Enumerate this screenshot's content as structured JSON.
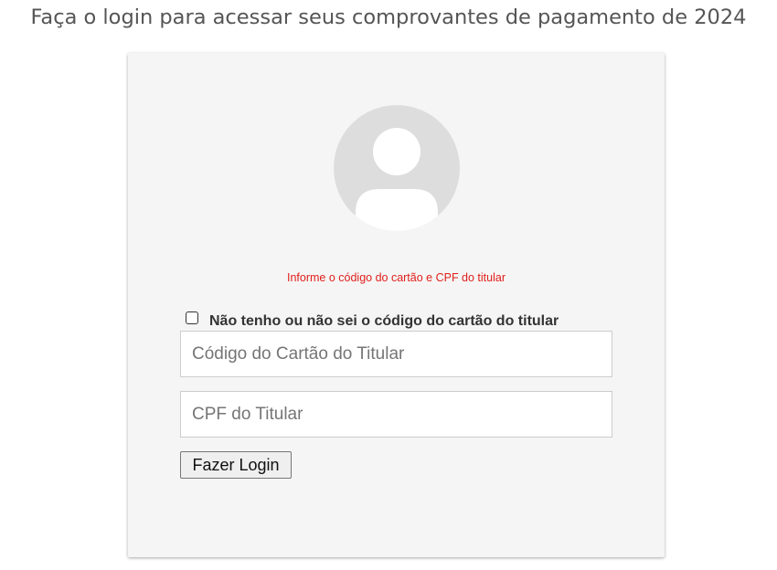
{
  "header": {
    "title": "Faça o login para acessar seus comprovantes de pagamento de 2024"
  },
  "login": {
    "avatar_icon": "user-avatar-icon",
    "message": "Informe o código do cartão e CPF do titular",
    "message_color": "#e0201c",
    "checkbox": {
      "label": "Não tenho ou não sei o código do cartão do titular",
      "checked": false
    },
    "card_code": {
      "placeholder": "Código do Cartão do Titular",
      "value": ""
    },
    "cpf": {
      "placeholder": "CPF do Titular",
      "value": ""
    },
    "submit_label": "Fazer Login"
  }
}
